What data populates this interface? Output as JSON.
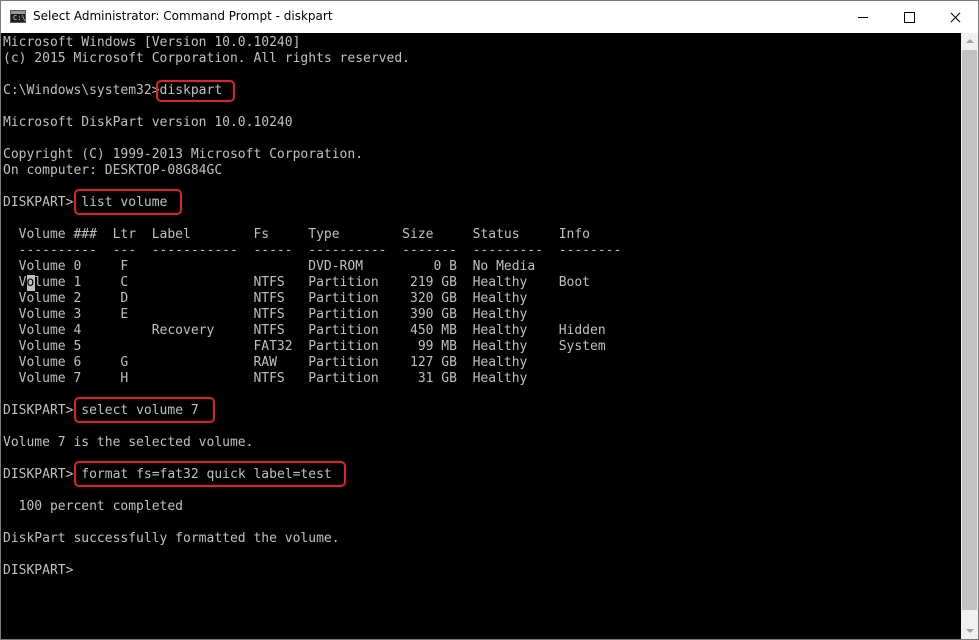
{
  "window": {
    "title": "Select Administrator: Command Prompt - diskpart",
    "icon": "cmd-icon",
    "controls": [
      "minimize",
      "maximize",
      "close"
    ]
  },
  "console": {
    "header_line1": "Microsoft Windows [Version 10.0.10240]",
    "header_line2": "(c) 2015 Microsoft Corporation. All rights reserved.",
    "prompt_path": "C:\\Windows\\system32>",
    "cmd_diskpart": "diskpart",
    "diskpart_version": "Microsoft DiskPart version 10.0.10240",
    "copyright": "Copyright (C) 1999-2013 Microsoft Corporation.",
    "computer": "On computer: DESKTOP-08G84GC",
    "diskpart_prompt": "DISKPART>",
    "cmd_list_volume": "list volume",
    "table_header": "  Volume ###  Ltr  Label        Fs     Type        Size     Status     Info",
    "table_separator": "  ----------  ---  -----------  -----  ----------  -------  ---------  --------",
    "volumes": [
      "  Volume 0     F                       DVD-ROM         0 B  No Media",
      "  Volume 1     C                NTFS   Partition    219 GB  Healthy    Boot",
      "  Volume 2     D                NTFS   Partition    320 GB  Healthy",
      "  Volume 3     E                NTFS   Partition    390 GB  Healthy",
      "  Volume 4         Recovery     NTFS   Partition    450 MB  Healthy    Hidden",
      "  Volume 5                      FAT32  Partition     99 MB  Healthy    System",
      "  Volume 6     G                RAW    Partition    127 GB  Healthy",
      "  Volume 7     H                NTFS   Partition     31 GB  Healthy"
    ],
    "cmd_select_volume": "select volume 7",
    "select_result": "Volume 7 is the selected volume.",
    "cmd_format": "format fs=fat32 quick label=test",
    "format_progress": "  100 percent completed",
    "format_result": "DiskPart successfully formatted the volume.",
    "colors": {
      "background": "#000000",
      "text": "#c0c0c0",
      "highlight": "#e0202a"
    }
  }
}
